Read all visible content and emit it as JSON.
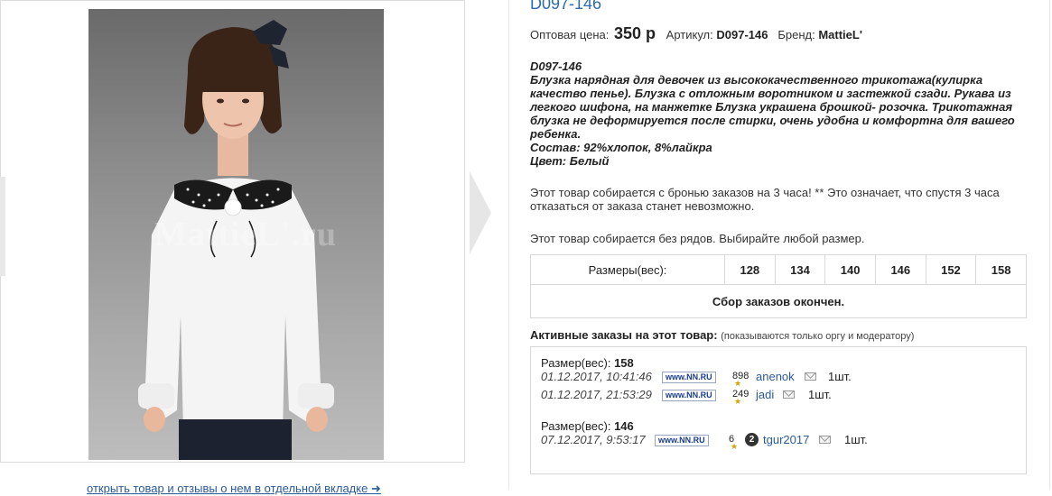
{
  "product": {
    "title": "D097-146",
    "price_label": "Оптовая цена:",
    "price": "350 р",
    "article_label": "Артикул:",
    "article": "D097-146",
    "brand_label": "Бренд:",
    "brand": "MattieL'"
  },
  "description": [
    "D097-146",
    "Блузка нарядная для девочек из высококачественного трикотажа(кулирка",
    "качество пенье). Блузка с отложным воротником и застежкой сзади. Рукава из",
    "легкого шифона, на манжетке Блузка украшена брошкой- розочка. Трикотажная",
    "блузка не деформируется после стирки, очень удобна и комфортна для вашего",
    "ребенка.",
    "Состав: 92%хлопок, 8%лайкра",
    "Цвет: Белый"
  ],
  "notes": {
    "reserve_line1": "Этот товар собирается с бронью заказов на 3 часа! ** Это означает, что спустя 3 часа",
    "reserve_line2": "отказаться от заказа станет невозможно.",
    "rows": "Этот товар собирается без рядов. Выбирайте любой размер."
  },
  "sizes_table": {
    "label": "Размеры(вес):",
    "sizes": [
      "128",
      "134",
      "140",
      "146",
      "152",
      "158"
    ],
    "status": "Сбор заказов окончен."
  },
  "orders": {
    "title": "Активные заказы на этот товар:",
    "subtitle": "(показываются только оргу и модератору)",
    "groups": [
      {
        "size_label": "Размер(вес):",
        "size": "158",
        "rows": [
          {
            "date": "01.12.2017, 10:41:46",
            "rating": "898",
            "user": "anenok",
            "qty": "1шт."
          },
          {
            "date": "01.12.2017, 21:53:29",
            "rating": "249",
            "user": "jadi",
            "qty": "1шт."
          }
        ]
      },
      {
        "size_label": "Размер(вес):",
        "size": "146",
        "rows": [
          {
            "date": "07.12.2017, 9:53:17",
            "rating": "6",
            "badge": "2",
            "user": "tgur2017",
            "qty": "1шт."
          }
        ]
      }
    ]
  },
  "nn_logo_text": "www.NN.RU",
  "watermark": "MattieL'.ru",
  "open_link": "открыть товар и отзывы о нем в отдельной вкладке ➜"
}
